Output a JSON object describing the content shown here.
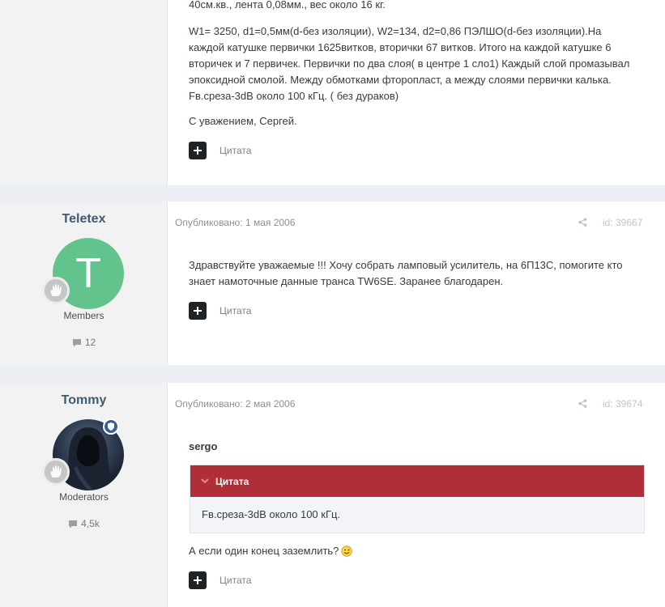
{
  "post0": {
    "paragraphs": [
      "40см.кв., лента 0,08мм., вес около 16 кг.",
      "W1= 3250, d1=0,5мм(d-без изоляции), W2=134, d2=0,86 ПЭЛШО(d-без изоляции).На",
      "каждой катушке первички 1625витков, вторички 67 витков. Итого на каждой катушке 6",
      "вторичек и 7 первичек. Первички по два слоя( в центре 1 сло1) Каждый слой промазывал",
      "эпоксидной смолой. Между обмотками фторопласт, а между слоями первички калька.",
      "Fв.среза-3dB около 100 кГц. ( без дураков)",
      "С уважением, Сергей."
    ],
    "quote_label": "Цитата"
  },
  "post1": {
    "username": "Teletex",
    "avatar_letter": "T",
    "group": "Members",
    "post_count": "12",
    "date": "Опубликовано: 1 мая 2006",
    "post_id": "id: 39667",
    "lines": [
      "Здравствуйте уважаемые !!! Хочу собрать ламповый усилитель, на 6П13С, помогите кто",
      "знает намоточные данные транса TW6SE. Заранее благодарен."
    ],
    "quote_label": "Цитата"
  },
  "post2": {
    "username": "Tommy",
    "group": "Moderators",
    "post_count": "4,5k",
    "date": "Опубликовано: 2 мая 2006",
    "post_id": "id: 39674",
    "quoted_author": "sergo",
    "quote_header": "Цитата",
    "quote_text": "Fв.среза-3dB около 100 кГц.",
    "reply_text": "А если один конец заземлить?",
    "quote_label": "Цитата"
  },
  "colors": {
    "accent_red": "#b02e37",
    "username_blue": "#3d5b73",
    "avatar_green": "#62c38d",
    "moderator_badge": "#3a5f96"
  },
  "icons": [
    "plus-icon",
    "share-icon",
    "comment-icon",
    "rank-hand-icon",
    "shield-icon",
    "chevron-down-icon",
    "wink-smiley-icon"
  ]
}
